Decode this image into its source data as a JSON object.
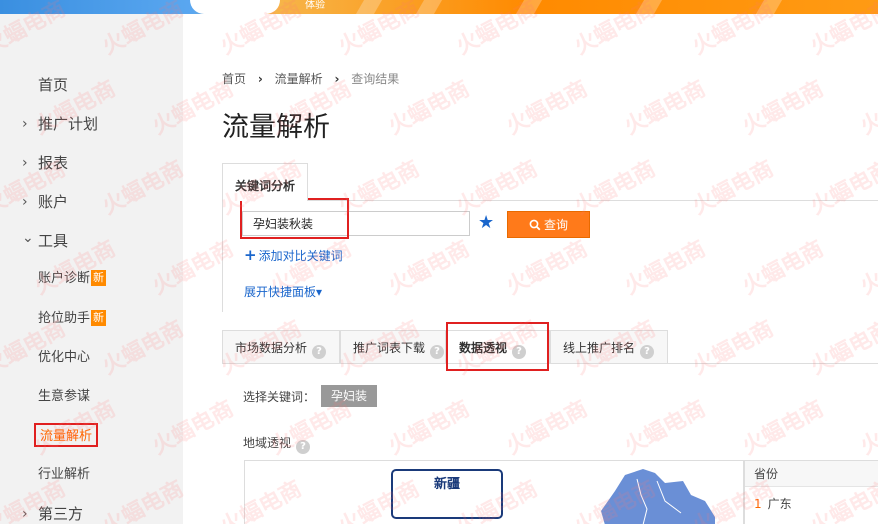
{
  "banner": {
    "text": "体验"
  },
  "sidebar": {
    "home": "首页",
    "items": [
      {
        "label": "推广计划",
        "chevron": "›"
      },
      {
        "label": "报表",
        "chevron": "›"
      },
      {
        "label": "账户",
        "chevron": "›"
      },
      {
        "label": "工具",
        "chevron": "⌄"
      }
    ],
    "tools": [
      {
        "label": "账户诊断",
        "badge": "新"
      },
      {
        "label": "抢位助手",
        "badge": "新"
      },
      {
        "label": "优化中心"
      },
      {
        "label": "生意参谋"
      },
      {
        "label": "流量解析",
        "active": true
      },
      {
        "label": "行业解析"
      }
    ],
    "third": {
      "label": "第三方",
      "chevron": "›"
    }
  },
  "breadcrumb": {
    "home": "首页",
    "section": "流量解析",
    "current": "查询结果",
    "sep": "›"
  },
  "page_title": "流量解析",
  "keyword_tab": "关键词分析",
  "search": {
    "value": "孕妇装秋装",
    "button": "查询"
  },
  "add_compare": "添加对比关键词",
  "quick_panel": "展开快捷面板▾",
  "tabs": [
    {
      "label": "市场数据分析"
    },
    {
      "label": "推广词表下载"
    },
    {
      "label": "数据透视",
      "active": true
    },
    {
      "label": "线上推广排名"
    }
  ],
  "select_keyword_label": "选择关键词：",
  "keyword_chip": "孕妇装",
  "geo_label": "地域透视",
  "map_tooltip": "新疆",
  "province_table": {
    "header": "省份",
    "rows": [
      {
        "rank": "1",
        "name": "广东"
      }
    ]
  },
  "watermark": "火蝠电商",
  "colors": {
    "accent": "#ff7a1a",
    "link": "#1a66cc",
    "highlight": "#e02020"
  }
}
